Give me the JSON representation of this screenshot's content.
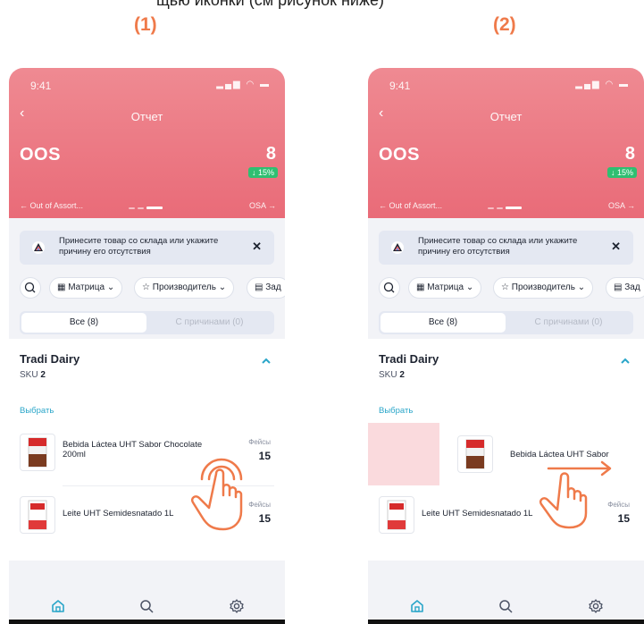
{
  "steps": [
    "(1)",
    "(2)"
  ],
  "status": {
    "time": "9:41"
  },
  "header": {
    "back": "‹",
    "title": "Отчет",
    "metric_name": "OOS",
    "metric_value": "8",
    "metric_delta": "↓ 15%",
    "nav_prev": "← Out of Assort...",
    "nav_next": "OSA →"
  },
  "notice": {
    "text": "Принесите товар со склада или укажите причину его отсутствия",
    "close": "✕"
  },
  "filters": {
    "chip_matrix": "Матрица",
    "chip_manufacturer": "Производитель",
    "chip_third": "Зад"
  },
  "segment": {
    "all": "Все (8)",
    "with_reasons": "С причинами (0)"
  },
  "group": {
    "title": "Tradi Dairy",
    "sku_label": "SKU",
    "sku_count": "2",
    "select": "Выбрать"
  },
  "products": [
    {
      "name": "Bebida Láctea UHT Sabor Chocolate 200ml",
      "name_swiped": "Bebida Láctea UHT Sabor",
      "label": "Фейсы",
      "value": "15"
    },
    {
      "name": "Leite UHT Semidesnatado 1L",
      "label": "Фейсы",
      "value": "15"
    }
  ],
  "colors": {
    "header": "#e96b78",
    "accent": "#2aa6c9",
    "delta": "#2fbf71",
    "step": "#ef7a4a",
    "hand": "#ef7a4a"
  },
  "icons": [
    "home-icon",
    "search-icon",
    "gear-icon",
    "close-icon",
    "chevron-up-icon",
    "hand-tap-icon",
    "hand-swipe-icon"
  ]
}
